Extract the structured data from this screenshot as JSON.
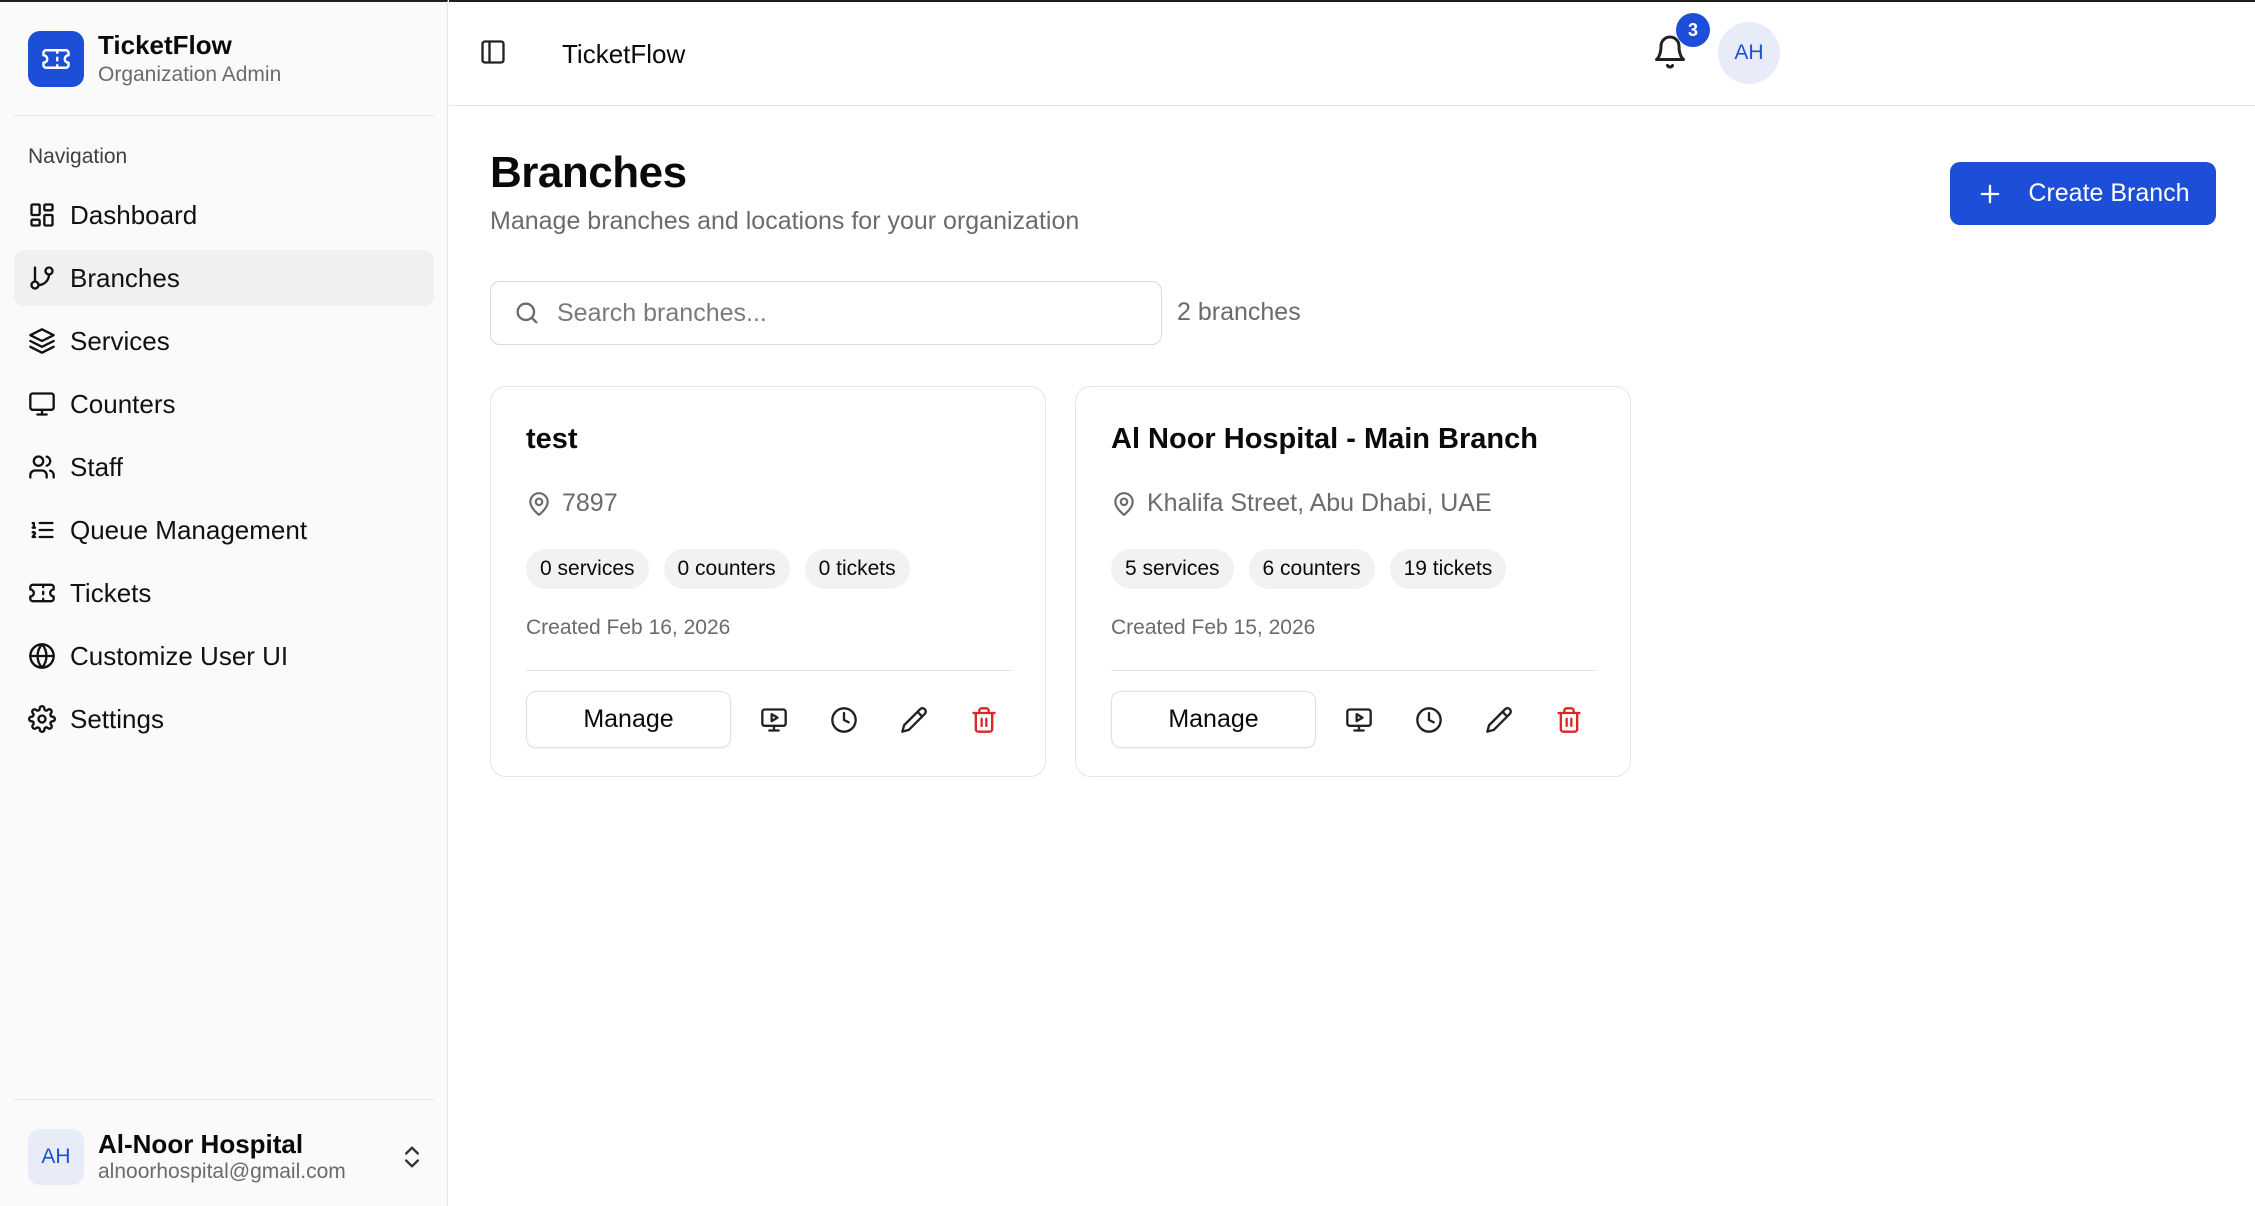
{
  "brand": {
    "name": "TicketFlow",
    "role": "Organization Admin"
  },
  "sidebar": {
    "section_label": "Navigation",
    "items": [
      {
        "label": "Dashboard",
        "icon": "dashboard-icon"
      },
      {
        "label": "Branches",
        "icon": "branch-icon",
        "active": true
      },
      {
        "label": "Services",
        "icon": "layers-icon"
      },
      {
        "label": "Counters",
        "icon": "monitor-icon"
      },
      {
        "label": "Staff",
        "icon": "users-icon"
      },
      {
        "label": "Queue Management",
        "icon": "list-icon"
      },
      {
        "label": "Tickets",
        "icon": "ticket-icon"
      },
      {
        "label": "Customize User UI",
        "icon": "globe-icon"
      },
      {
        "label": "Settings",
        "icon": "gear-icon"
      }
    ],
    "user": {
      "initials": "AH",
      "name": "Al-Noor Hospital",
      "email": "alnoorhospital@gmail.com"
    }
  },
  "topbar": {
    "title": "TicketFlow",
    "notification_count": "3",
    "avatar_initials": "AH"
  },
  "main": {
    "title": "Branches",
    "subtitle": "Manage branches and locations for your organization",
    "create_label": "Create Branch",
    "search_placeholder": "Search branches...",
    "count_label": "2 branches",
    "cards": [
      {
        "name": "test",
        "address": "7897",
        "services": "0 services",
        "counters": "0 counters",
        "tickets": "0 tickets",
        "created": "Created Feb 16, 2026",
        "manage_label": "Manage"
      },
      {
        "name": "Al Noor Hospital - Main Branch",
        "address": "Khalifa Street, Abu Dhabi, UAE",
        "services": "5 services",
        "counters": "6 counters",
        "tickets": "19 tickets",
        "created": "Created Feb 15, 2026",
        "manage_label": "Manage"
      }
    ]
  },
  "colors": {
    "accent": "#1d4ed8",
    "danger": "#dc2626",
    "muted": "#6b6b6b"
  }
}
